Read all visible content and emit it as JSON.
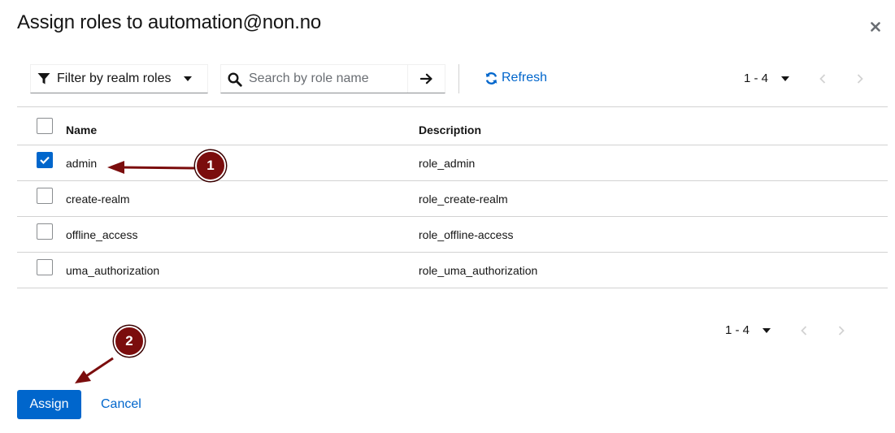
{
  "dialog": {
    "title": "Assign roles to automation@non.no"
  },
  "toolbar": {
    "filter_label": "Filter by realm roles",
    "search_placeholder": "Search by role name",
    "search_value": "",
    "refresh_label": "Refresh",
    "pagination_range": "1 - 4"
  },
  "table": {
    "headers": {
      "name": "Name",
      "description": "Description"
    },
    "rows": [
      {
        "name": "admin",
        "description": "role_admin",
        "checked": true
      },
      {
        "name": "create-realm",
        "description": "role_create-realm",
        "checked": false
      },
      {
        "name": "offline_access",
        "description": "role_offline-access",
        "checked": false
      },
      {
        "name": "uma_authorization",
        "description": "role_uma_authorization",
        "checked": false
      }
    ]
  },
  "footer": {
    "pagination_range": "1 - 4",
    "assign_label": "Assign",
    "cancel_label": "Cancel"
  },
  "annotations": {
    "step1": "1",
    "step2": "2",
    "color": "#7b0d0d"
  },
  "colors": {
    "primary": "#0066cc",
    "text": "#151515",
    "border": "#d2d2d2"
  },
  "icons": {
    "close": "close-icon",
    "filter": "filter-icon",
    "search": "search-icon",
    "go": "arrow-right-icon",
    "refresh": "sync-icon"
  }
}
